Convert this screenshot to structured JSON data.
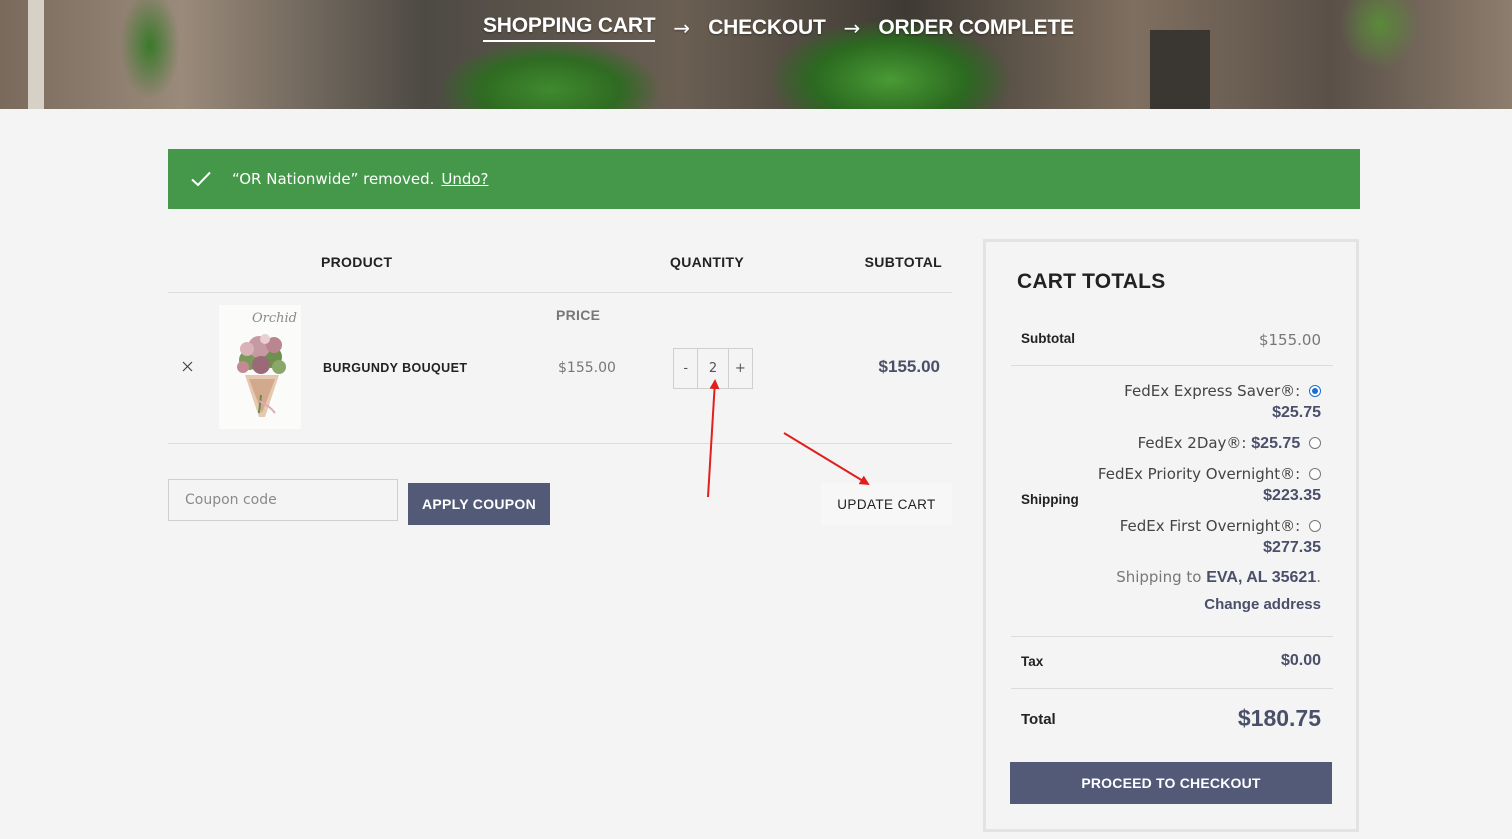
{
  "steps": {
    "shopping_cart": "SHOPPING CART",
    "checkout": "CHECKOUT",
    "order_complete": "ORDER COMPLETE",
    "arrow": "→"
  },
  "notice": {
    "message": "“OR Nationwide” removed.",
    "undo_label": "Undo?",
    "color": "#45984a"
  },
  "cart": {
    "headers": {
      "product": "PRODUCT",
      "price": "PRICE",
      "quantity": "QUANTITY",
      "subtotal": "SUBTOTAL"
    },
    "items": [
      {
        "name": "BURGUNDY BOUQUET",
        "image_script": "Orchid",
        "price": "$155.00",
        "quantity": "2",
        "subtotal": "$155.00",
        "minus": "-",
        "plus": "+",
        "remove_icon": "close-icon"
      }
    ],
    "coupon_placeholder": "Coupon code",
    "apply_coupon_label": "APPLY COUPON",
    "update_cart_label": "UPDATE CART"
  },
  "totals": {
    "title": "CART TOTALS",
    "subtotal_label": "Subtotal",
    "subtotal_value": "$155.00",
    "shipping_label": "Shipping",
    "shipping_options": [
      {
        "name": "FedEx Express Saver®:",
        "price": "$25.75",
        "selected": true
      },
      {
        "name": "FedEx 2Day®:",
        "price": "$25.75",
        "selected": false
      },
      {
        "name": "FedEx Priority Overnight®:",
        "price": "$223.35",
        "selected": false
      },
      {
        "name": "FedEx First Overnight®:",
        "price": "$277.35",
        "selected": false
      }
    ],
    "shipping_to_prefix": "Shipping to",
    "shipping_to_place": "EVA, AL 35621",
    "shipping_to_suffix": ".",
    "change_address_label": "Change address",
    "tax_label": "Tax",
    "tax_value": "$0.00",
    "total_label": "Total",
    "total_value": "$180.75",
    "checkout_label": "PROCEED TO CHECKOUT"
  },
  "colors": {
    "accent": "#535a78",
    "amount": "#4a4f6a",
    "annotation": "#e0201c"
  }
}
